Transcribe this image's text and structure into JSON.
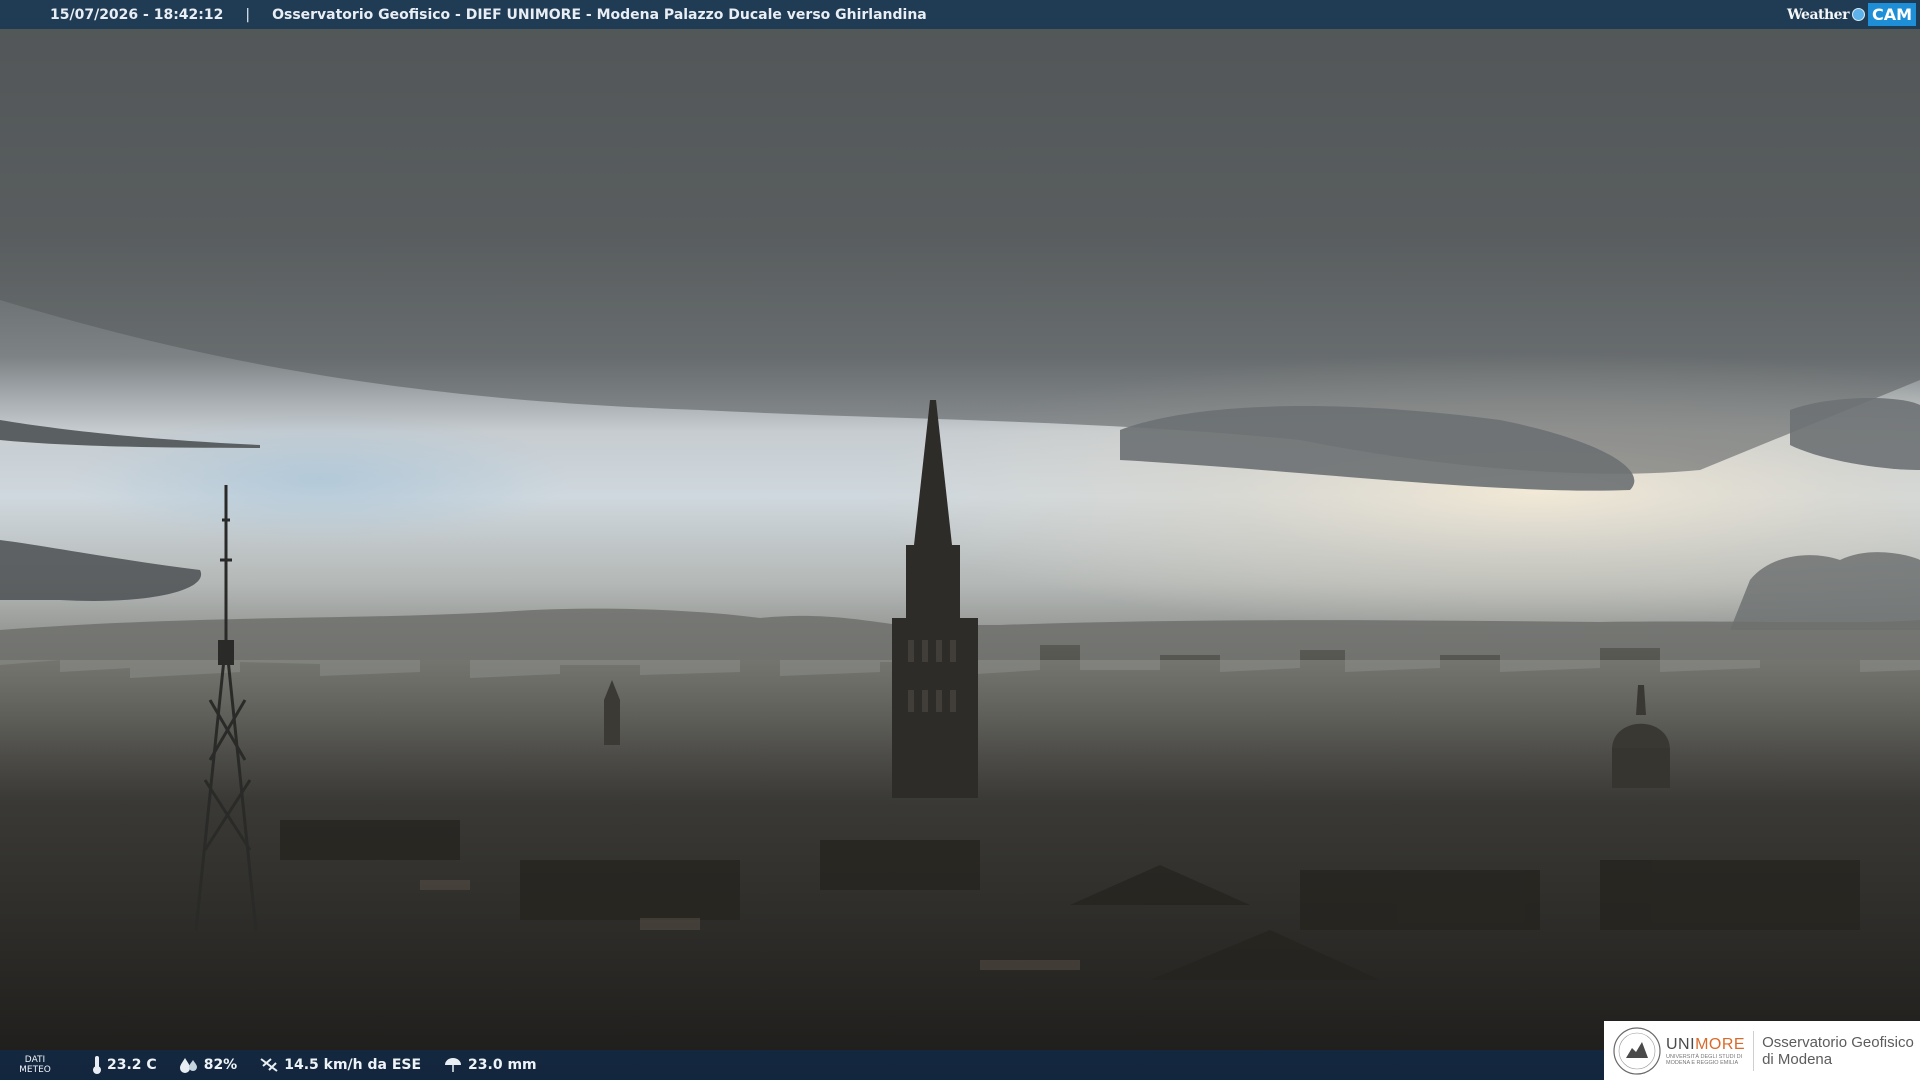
{
  "topbar": {
    "datetime": "15/07/2026 - 18:42:12",
    "separator": "|",
    "title": "Osservatorio Geofisico - DIEF UNIMORE - Modena Palazzo Ducale verso Ghirlandina",
    "brand_left": "Weather",
    "brand_right": "CAM"
  },
  "weather": {
    "label_line1": "DATI",
    "label_line2": "METEO",
    "temperature": "23.2 C",
    "humidity": "82%",
    "wind": "14.5 km/h da ESE",
    "rain": "23.0 mm"
  },
  "logo": {
    "uni_part1": "UNI",
    "uni_part2": "MORE",
    "uni_sub1": "UNIVERSITÀ DEGLI STUDI DI",
    "uni_sub2": "MODENA E REGGIO EMILIA",
    "obs_line1": "Osservatorio Geofisico",
    "obs_line2": "di Modena"
  },
  "colors": {
    "bar_top": "#1c3854",
    "bar_bottom": "#122842",
    "accent": "#1e8fd6",
    "unimore_orange": "#d96a2b"
  }
}
